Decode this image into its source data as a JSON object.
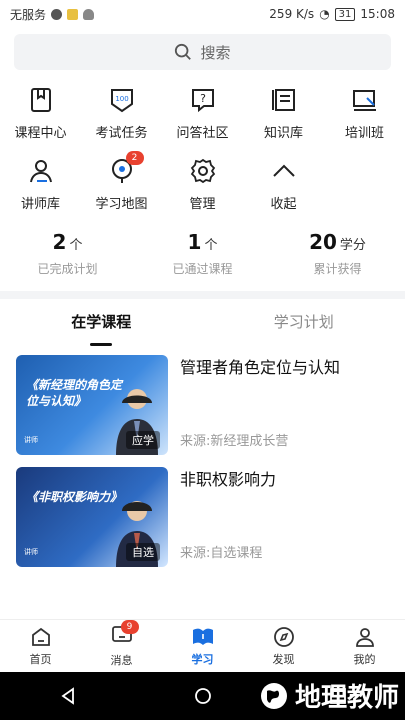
{
  "status": {
    "carrier": "无服务",
    "speed": "259 K/s",
    "battery": "31",
    "time": "15:08"
  },
  "search": {
    "label": "搜索"
  },
  "grid": [
    {
      "label": "课程中心",
      "icon": "book-icon"
    },
    {
      "label": "考试任务",
      "icon": "exam-icon"
    },
    {
      "label": "问答社区",
      "icon": "qa-icon"
    },
    {
      "label": "知识库",
      "icon": "library-icon"
    },
    {
      "label": "培训班",
      "icon": "training-icon"
    },
    {
      "label": "讲师库",
      "icon": "lecturer-icon"
    },
    {
      "label": "学习地图",
      "icon": "map-icon",
      "badge": "2"
    },
    {
      "label": "管理",
      "icon": "gear-icon"
    },
    {
      "label": "收起",
      "icon": "collapse-icon"
    }
  ],
  "stats": [
    {
      "value": "2",
      "unit": "个",
      "label": "已完成计划"
    },
    {
      "value": "1",
      "unit": "个",
      "label": "已通过课程"
    },
    {
      "value": "20",
      "unit": "学分",
      "label": "累计获得"
    }
  ],
  "tabs": [
    {
      "label": "在学课程"
    },
    {
      "label": "学习计划"
    }
  ],
  "courses": [
    {
      "title": "管理者角色定位与认知",
      "source": "来源:新经理成长营",
      "thumb_title": "《新经理的角色定位与认知》",
      "thumb_tag": "应学",
      "speaker_label": "讲师"
    },
    {
      "title": "非职权影响力",
      "source": "来源:自选课程",
      "thumb_title": "《非职权影响力》",
      "thumb_tag": "自选",
      "speaker_label": "讲师"
    }
  ],
  "tabbar": [
    {
      "label": "首页"
    },
    {
      "label": "消息",
      "badge": "9"
    },
    {
      "label": "学习"
    },
    {
      "label": "发现"
    },
    {
      "label": "我的"
    }
  ],
  "watermark": {
    "text": "地理教师"
  },
  "colors": {
    "accent": "#1a6fe0",
    "badge": "#e8412f"
  }
}
